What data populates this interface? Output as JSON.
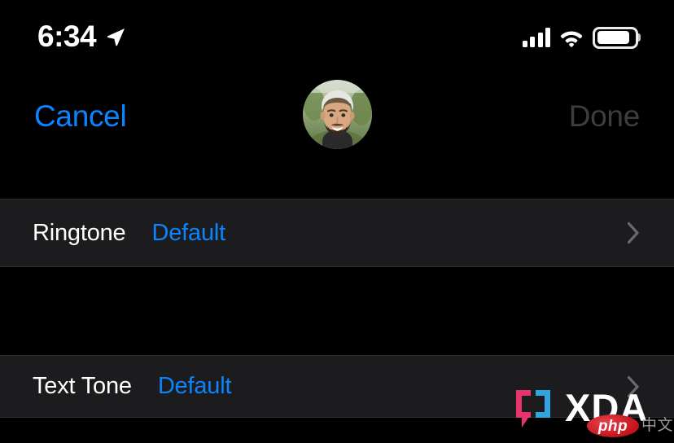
{
  "status_bar": {
    "time": "6:34",
    "location_icon": "location-arrow-icon",
    "signal_icon": "cellular-signal-icon",
    "signal_bars_filled": 4,
    "wifi_icon": "wifi-icon",
    "battery_icon": "battery-icon",
    "battery_level_percent": 88
  },
  "nav_bar": {
    "cancel_label": "Cancel",
    "done_label": "Done",
    "done_disabled": true,
    "avatar_name": "contact-avatar"
  },
  "sections": [
    {
      "id": "ringtone",
      "label": "Ringtone",
      "value": "Default",
      "chevron_icon": "chevron-right-icon"
    },
    {
      "id": "texttone",
      "label": "Text Tone",
      "value": "Default",
      "chevron_icon": "chevron-right-icon"
    }
  ],
  "watermark": {
    "brand": "XDA",
    "badge": "php",
    "suffix": "中文网",
    "logo_left_color": "#e8336d",
    "logo_right_color": "#32a5e0"
  },
  "colors": {
    "page_background": "#000000",
    "row_background": "#1c1c1e",
    "accent_blue": "#0a84ff",
    "disabled_gray": "#3d3d3f",
    "primary_text": "#ffffff",
    "separator": "#2e2e30"
  }
}
